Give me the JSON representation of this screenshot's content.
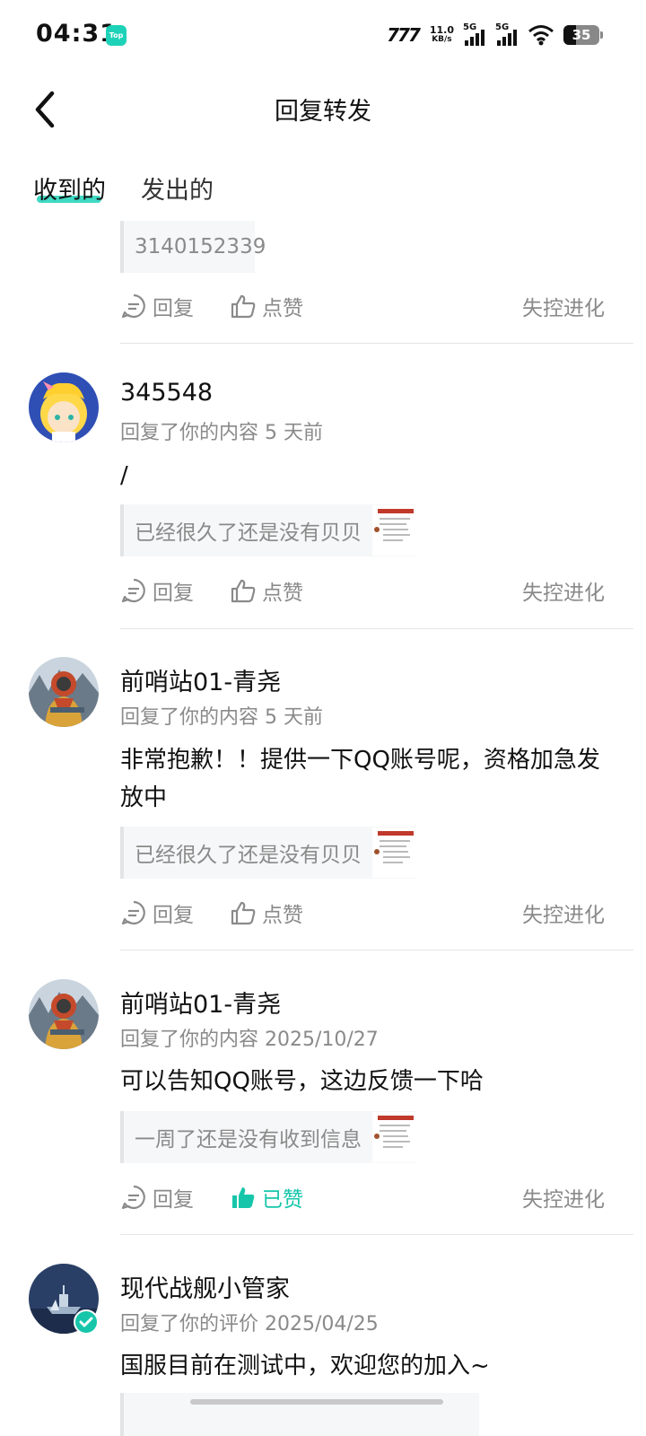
{
  "status_bar": {
    "time": "04:31",
    "app_badge": "Top",
    "hd": "777",
    "speed_value": "11.0",
    "speed_unit": "KB/s",
    "sim1": "5G",
    "sim2": "5G",
    "battery": "35"
  },
  "header": {
    "title": "回复转发"
  },
  "tabs": [
    {
      "label": "收到的",
      "active": true
    },
    {
      "label": "发出的",
      "active": false
    }
  ],
  "feed": [
    {
      "quote": "3140152339",
      "actions": {
        "reply": "回复",
        "like": "点赞",
        "group": "失控进化"
      }
    },
    {
      "username": "345548",
      "meta": "回复了你的内容 5 天前",
      "text": "/",
      "quote": "已经很久了还是没有贝贝",
      "actions": {
        "reply": "回复",
        "like": "点赞",
        "group": "失控进化"
      }
    },
    {
      "username": "前哨站01-青尧",
      "meta": "回复了你的内容 5 天前",
      "text": "非常抱歉！！提供一下QQ账号呢，资格加急发放中",
      "quote": "已经很久了还是没有贝贝",
      "actions": {
        "reply": "回复",
        "like": "点赞",
        "group": "失控进化"
      }
    },
    {
      "username": "前哨站01-青尧",
      "meta": "回复了你的内容 2025/10/27",
      "text": "可以告知QQ账号，这边反馈一下哈",
      "quote": "一周了还是没有收到信息",
      "actions": {
        "reply": "回复",
        "like": "已赞",
        "group": "失控进化"
      }
    },
    {
      "username": "现代战舰小管家",
      "meta": "回复了你的评价 2025/04/25",
      "text": "国服目前在测试中，欢迎您的加入~"
    }
  ],
  "colors": {
    "accent": "#1ed2b8",
    "liked": "#17c6aa",
    "muted": "#8a8a8a"
  },
  "icons": [
    "back-arrow-icon",
    "reply-bubble-icon",
    "thumbs-up-icon",
    "thumbs-up-filled-icon",
    "verified-badge-icon"
  ]
}
